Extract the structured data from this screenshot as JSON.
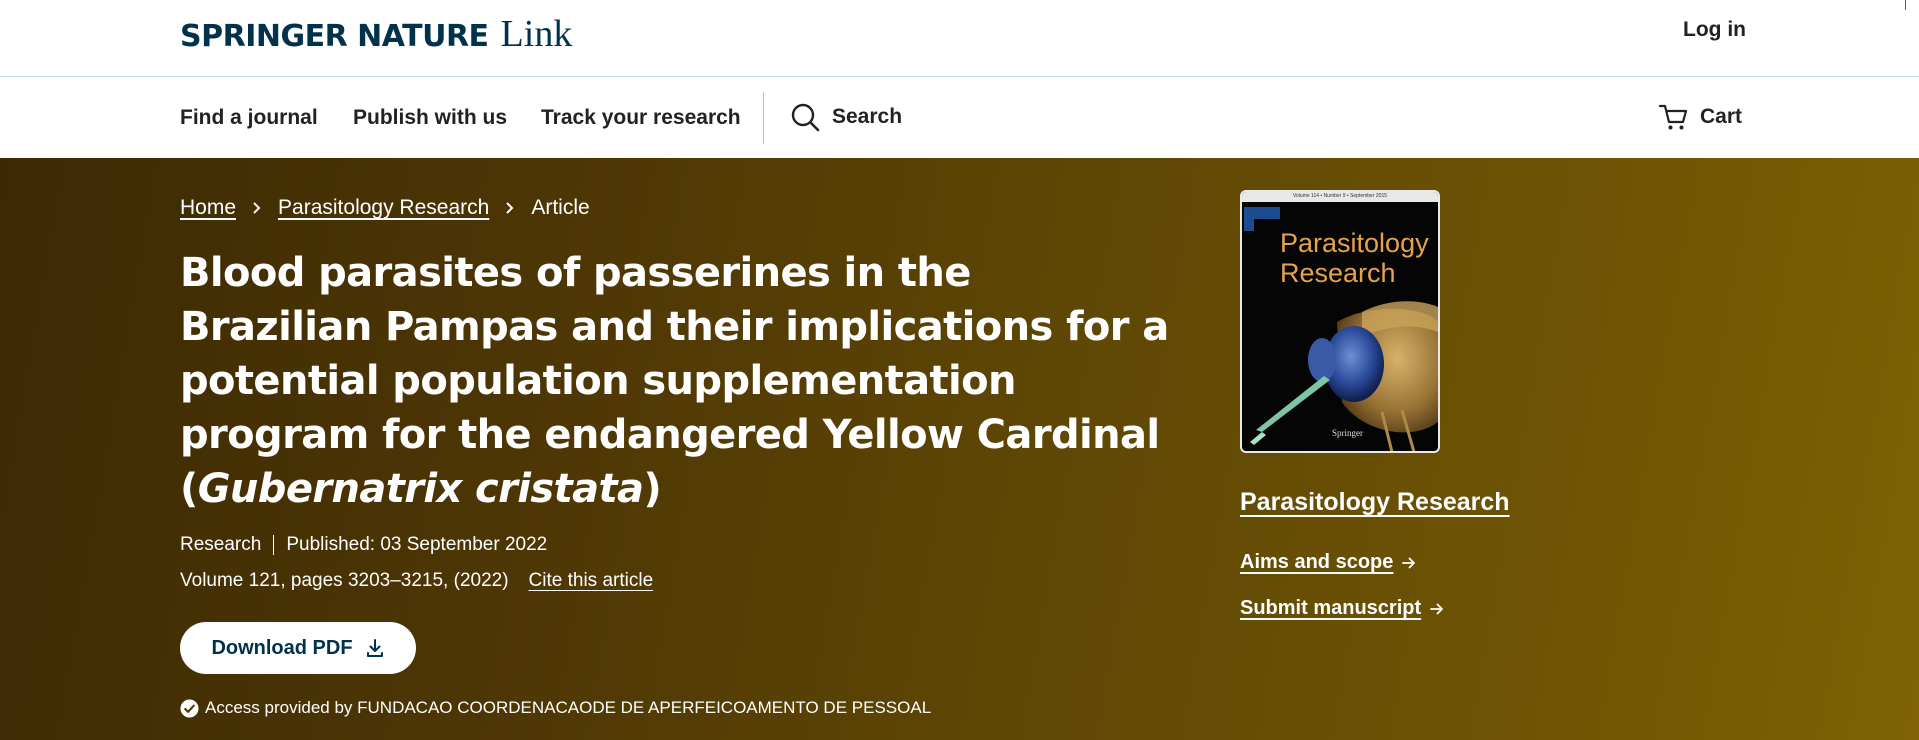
{
  "header": {
    "logo_brand": "SPRINGER NATURE",
    "logo_link": "Link",
    "login_label": "Log in"
  },
  "nav": {
    "items": [
      "Find a journal",
      "Publish with us",
      "Track your research"
    ],
    "search_label": "Search",
    "cart_label": "Cart"
  },
  "breadcrumb": {
    "home": "Home",
    "journal": "Parasitology Research",
    "current": "Article"
  },
  "article": {
    "title_main": "Blood parasites of passerines in the Brazilian Pampas and their implications for a potential population supplementation program for the endangered Yellow Cardinal (",
    "title_italic": "Gubernatrix cristata",
    "title_end": ")",
    "type": "Research",
    "published": "Published: 03 September 2022",
    "volume_info": "Volume 121, pages 3203–3215, (2022)",
    "cite_label": "Cite this article",
    "download_label": "Download PDF",
    "access_text": "Access provided by FUNDACAO COORDENACAODE DE APERFEICOAMENTO DE PESSOAL"
  },
  "sidebar": {
    "cover_title_line1": "Parasitology",
    "cover_title_line2": "Research",
    "cover_small_text": "Volume 114 • Number 9 • September 2015",
    "cover_publisher": "Springer",
    "journal_link": "Parasitology Research",
    "aims_label": "Aims and scope",
    "submit_label": "Submit manuscript"
  },
  "icons": {
    "search": "search-icon",
    "cart": "cart-icon",
    "download": "download-icon",
    "check": "check-circle-icon",
    "chevron": "chevron-right-icon",
    "arrow": "arrow-right-icon"
  },
  "colors": {
    "brand_navy": "#01324b",
    "hero_start": "#3d2a04",
    "hero_end": "#7e6205",
    "cover_title": "#e7a24a"
  }
}
